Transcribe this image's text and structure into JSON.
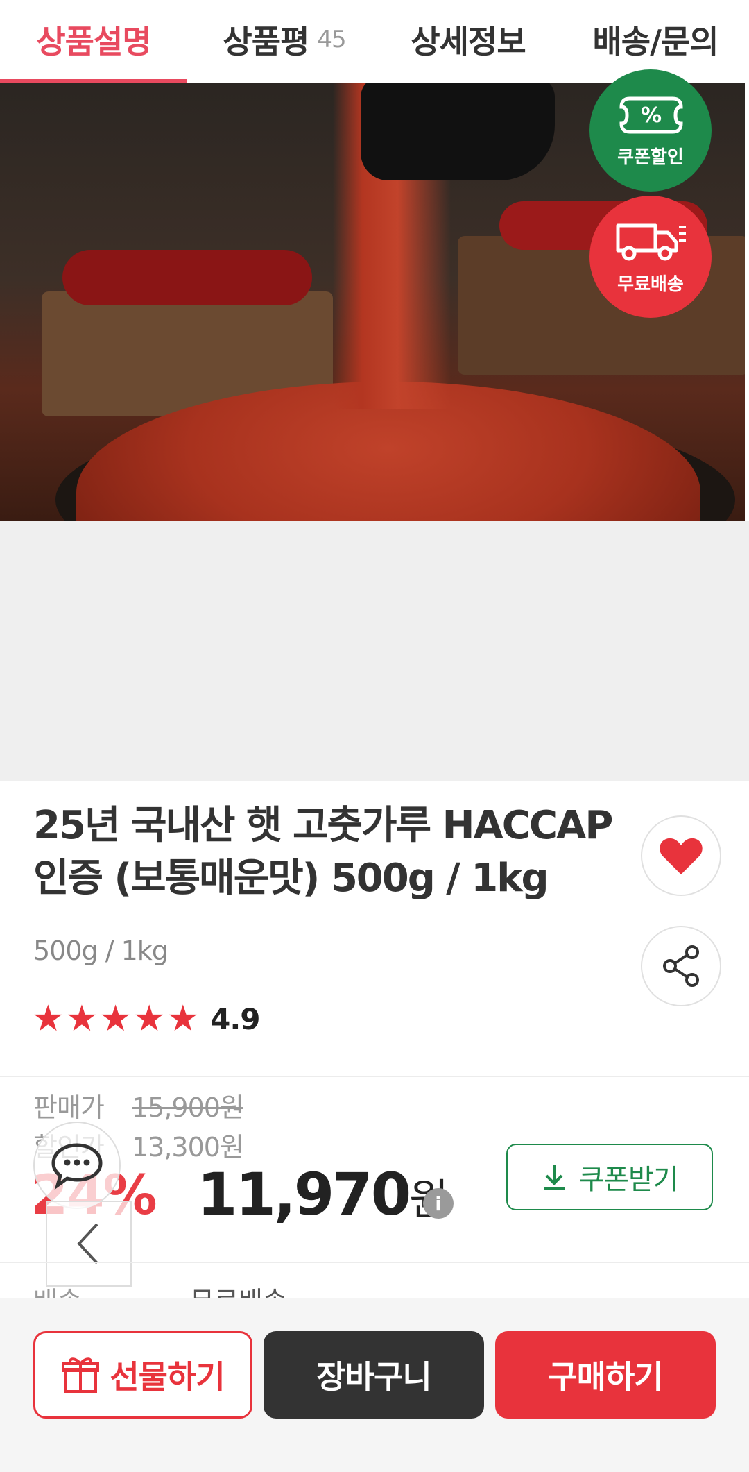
{
  "tabs": [
    {
      "label": "상품설명",
      "count": ""
    },
    {
      "label": "상품평",
      "count": "45"
    },
    {
      "label": "상세정보",
      "count": ""
    },
    {
      "label": "배송/문의",
      "count": ""
    }
  ],
  "badges": {
    "coupon_label": "쿠폰할인",
    "coupon_symbol": "%",
    "shipping_label": "무료배송"
  },
  "product": {
    "title": "25년 국내산 햇 고춧가루 HACCAP 인증 (보통매운맛) 500g / 1kg",
    "option_text": "500g / 1kg",
    "rating": "4.9",
    "stars_filled": 5,
    "stars_total": 5
  },
  "pricing": {
    "sale_label": "판매가",
    "sale_price": "15,900원",
    "discount_label": "할인가",
    "discount_price": "13,300원",
    "discount_percent": "24%",
    "final_price": "11,970",
    "final_currency": "원",
    "info_symbol": "i",
    "coupon_button": "쿠폰받기"
  },
  "shipping": {
    "label": "배송",
    "value": "무료배송"
  },
  "bottom_bar": {
    "gift_label": "선물하기",
    "cart_label": "장바구니",
    "buy_label": "구매하기"
  },
  "colors": {
    "accent_red": "#e8333c",
    "tab_active": "#e84a5f",
    "coupon_green": "#1e8a4b",
    "dark_button": "#333333"
  }
}
